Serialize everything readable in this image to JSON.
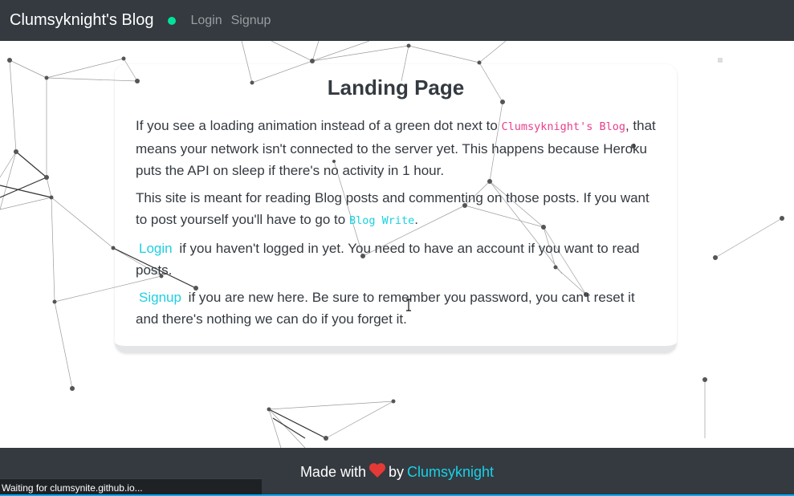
{
  "navbar": {
    "brand": "Clumsyknight's Blog",
    "status_color": "#00e39a",
    "links": {
      "login": "Login",
      "signup": "Signup"
    }
  },
  "card": {
    "title": "Landing Page",
    "p1_before": "If you see a loading animation instead of a green dot next to ",
    "p1_code": "Clumsyknight's Blog",
    "p1_after": ", that means your network isn't connected to the server yet. This happens because Heroku puts the API on sleep if there's no activity in 1 hour.",
    "p2_before": "This site is meant for reading Blog posts and commenting on those posts. If you want to post yourself you'll have to go to ",
    "p2_code": "Blog Write",
    "p2_after": ".",
    "p3_link": "Login",
    "p3_text": " if you haven't logged in yet. You need to have an account if you want to read posts.",
    "p4_link": "Signup",
    "p4_text": " if you are new here. Be sure to remember you password, you can't reset it and there's nothing we can do if you forget it."
  },
  "footer": {
    "made_with": "Made with",
    "heart_icon": "heart-icon",
    "by": "by",
    "author": "Clumsyknight"
  },
  "statusbar": {
    "text": "Waiting for clumsynite.github.io..."
  },
  "colors": {
    "nav_bg": "#343a40",
    "accent_cyan": "#19d1e6",
    "code_pink": "#e83e8c",
    "status_dot": "#00e39a",
    "heart": "#e53935"
  }
}
